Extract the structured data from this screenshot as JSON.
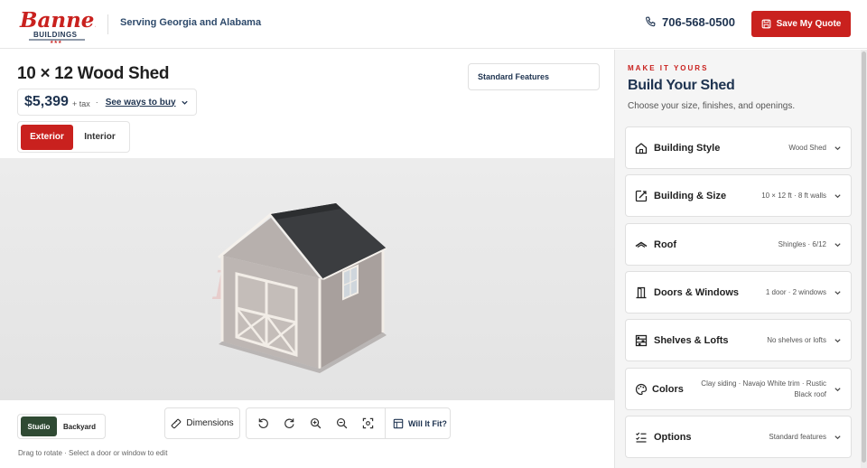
{
  "header": {
    "brand_name": "Banner",
    "brand_sub": "BUILDINGS",
    "serving": "Serving Georgia and Alabama",
    "phone": "706-568-0500",
    "save_label": "Save My Quote"
  },
  "product": {
    "title": "10 × 12 Wood Shed",
    "price": "$5,399",
    "tax": "+ tax",
    "separator": "·",
    "ways_to_buy": "See ways to buy",
    "standard_features": "Standard Features"
  },
  "view_tabs": {
    "exterior": "Exterior",
    "interior": "Interior"
  },
  "viewer": {
    "studio": "Studio",
    "backyard": "Backyard",
    "dimensions": "Dimensions",
    "will_it_fit": "Will It Fit?",
    "hint": "Drag to rotate · Select a door or window to edit"
  },
  "panel": {
    "eyebrow": "MAKE IT YOURS",
    "title": "Build Your Shed",
    "subtitle": "Choose your size, finishes, and openings.",
    "options": [
      {
        "label": "Building Style",
        "value": "Wood Shed",
        "icon": "house-icon"
      },
      {
        "label": "Building & Size",
        "value": "10 × 12 ft · 8 ft walls",
        "icon": "resize-icon"
      },
      {
        "label": "Roof",
        "value": "Shingles · 6/12",
        "icon": "roof-icon"
      },
      {
        "label": "Doors & Windows",
        "value": "1 door · 2 windows",
        "icon": "door-icon"
      },
      {
        "label": "Shelves & Lofts",
        "value": "No shelves or lofts",
        "icon": "shelves-icon"
      },
      {
        "label": "Colors",
        "value": "Clay siding · Navajo White trim · Rustic Black roof",
        "icon": "palette-icon"
      },
      {
        "label": "Options",
        "value": "Standard features",
        "icon": "checklist-icon"
      }
    ]
  },
  "colors": {
    "brand_red": "#c9211e",
    "navy": "#1e3350",
    "studio_green": "#2f4a33"
  }
}
